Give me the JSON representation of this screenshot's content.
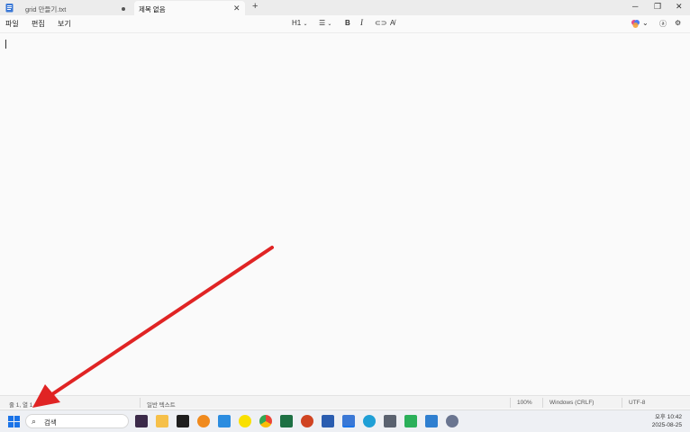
{
  "tabs": [
    {
      "label": "grid 만들기.txt",
      "unsaved": true
    },
    {
      "label": "제목 없음",
      "active": true
    }
  ],
  "menu": [
    "파일",
    "편집",
    "보기"
  ],
  "toolbar": {
    "heading": "H1",
    "bold": "B",
    "italic": "I"
  },
  "editor": {
    "content": ""
  },
  "status": {
    "position": "줄 1, 열 1",
    "mode": "일반 텍스트",
    "zoom": "100%",
    "line_ending": "Windows (CRLF)",
    "encoding": "UTF-8"
  },
  "taskbar": {
    "search_placeholder": "검색",
    "time": "오후 10:42",
    "date": "2025-08-25",
    "apps": [
      "jpg-app-icon",
      "file-explorer-icon",
      "terminal-icon",
      "magnifier-icon",
      "vscode-icon",
      "kakaotalk-icon",
      "chrome-icon",
      "excel-icon",
      "powerpoint-icon",
      "word-icon",
      "notepad-icon",
      "edge-icon",
      "calculator-icon",
      "vs-icon",
      "photos-icon",
      "settings-icon"
    ]
  },
  "colors": {
    "accent": "#1a73e8",
    "annotation_arrow": "#e02424"
  }
}
